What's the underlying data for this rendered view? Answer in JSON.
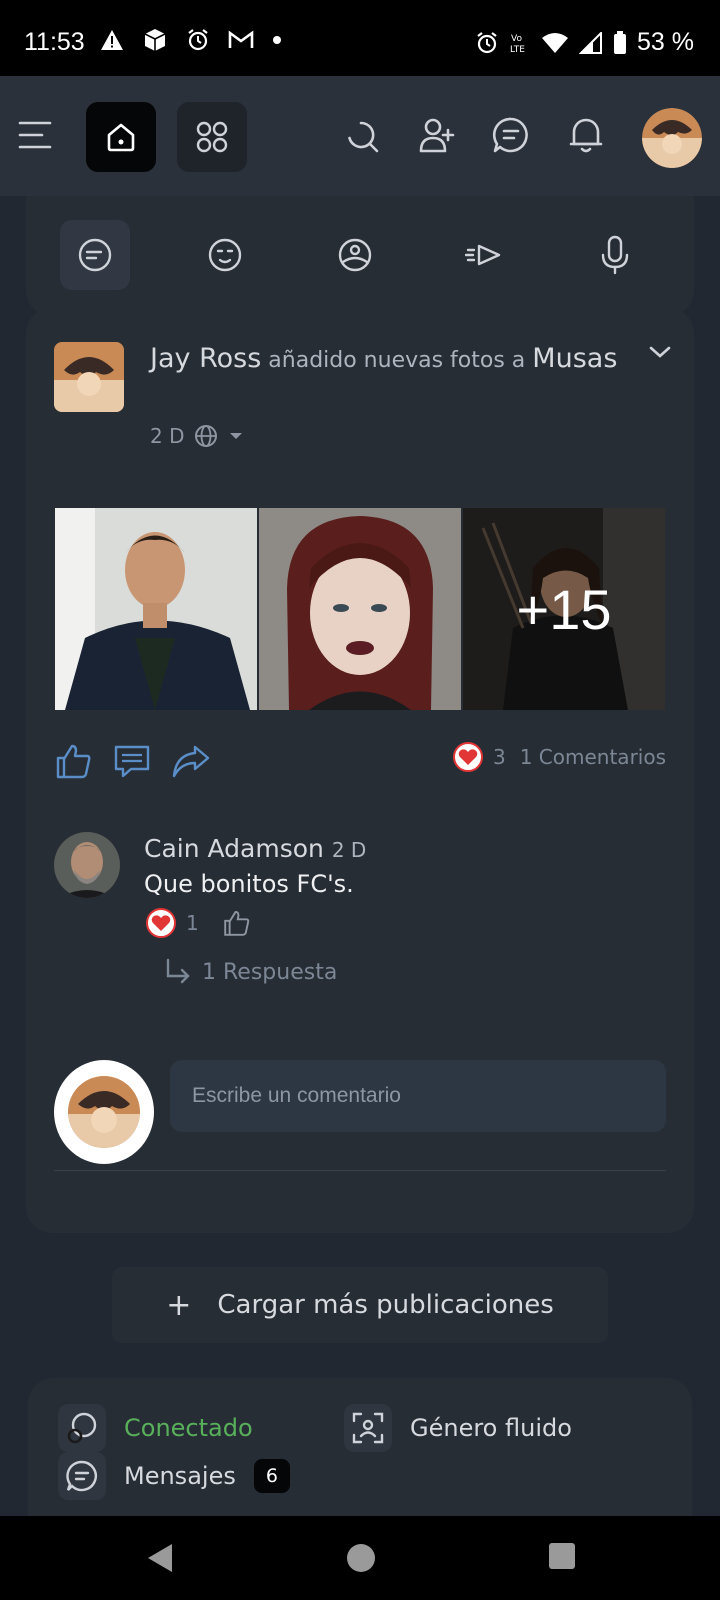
{
  "status_bar": {
    "time": "11:53",
    "battery": "53 %",
    "icons": [
      "warning-icon",
      "package-icon",
      "alarm-icon",
      "gmail-icon",
      "dot-icon",
      "alarm-icon",
      "volte-icon",
      "wifi-icon",
      "signal-icon",
      "battery-icon"
    ]
  },
  "top_nav": {
    "icons": [
      "menu-icon",
      "home-icon",
      "apps-icon",
      "search-icon",
      "add-user-icon",
      "messages-icon",
      "bell-icon",
      "profile-avatar"
    ]
  },
  "composer": {
    "icons": [
      "post-icon",
      "emoji-icon",
      "photo-icon",
      "video-icon",
      "mic-icon"
    ]
  },
  "post": {
    "author": "Jay Ross",
    "action": "añadido nuevas fotos a",
    "target": "Musas",
    "time": "2 D",
    "photos_more": "+15",
    "reaction_count": "3",
    "comments_count": "1 Comentarios"
  },
  "comment": {
    "author": "Cain Adamson",
    "time": "2 D",
    "text": "Que bonitos FC's.",
    "reaction_count": "1",
    "replies": "1 Respuesta"
  },
  "write_comment": {
    "placeholder": "Escribe un comentario"
  },
  "load_more": {
    "label": "Cargar más publicaciones",
    "plus": "+"
  },
  "profile_info": {
    "status": "Conectado",
    "gender": "Género fluido",
    "messages_label": "Mensajes",
    "messages_count": "6"
  },
  "colors": {
    "background": "#222831",
    "card": "#272d35",
    "online": "#58b05a",
    "heart": "#e23535"
  }
}
